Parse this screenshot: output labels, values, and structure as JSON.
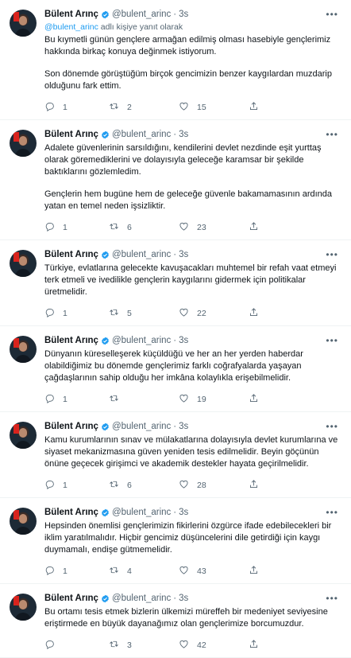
{
  "author": {
    "name": "Bülent Arınç",
    "handle": "@bulent_arinc",
    "time": "3s",
    "verified": true
  },
  "reply_prefix": "@bulent_arinc",
  "reply_suffix": "adlı kişiye yanıt olarak",
  "colors": {
    "accent": "#1d9bf0",
    "text": "#0f1419",
    "muted": "#536471"
  },
  "icons": {
    "reply": "reply-icon",
    "retweet": "retweet-icon",
    "like": "heart-icon",
    "share": "share-icon",
    "more": "more-icon"
  },
  "tweets": [
    {
      "paragraphs": [
        "Bu kıymetli günün gençlere armağan edilmiş olması hasebiyle gençlerimiz hakkında birkaç konuya değinmek istiyorum.",
        "Son dönemde görüştüğüm birçok gencimizin benzer kaygılardan muzdarip olduğunu fark ettim."
      ],
      "replies": "1",
      "retweets": "2",
      "likes": "15"
    },
    {
      "paragraphs": [
        "Adalete güvenlerinin sarsıldığını, kendilerini devlet nezdinde eşit yurttaş olarak göremediklerini ve dolayısıyla geleceğe karamsar bir şekilde baktıklarını gözlemledim.",
        "Gençlerin hem bugüne hem de geleceğe güvenle bakamamasının ardında yatan en temel neden işsizliktir."
      ],
      "replies": "1",
      "retweets": "6",
      "likes": "23"
    },
    {
      "paragraphs": [
        "Türkiye, evlatlarına gelecekte kavuşacakları muhtemel bir refah vaat etmeyi terk etmeli ve ivedilikle gençlerin kaygılarını gidermek için politikalar üretmelidir."
      ],
      "replies": "1",
      "retweets": "5",
      "likes": "22"
    },
    {
      "paragraphs": [
        "Dünyanın küreselleşerek küçüldüğü ve her an her yerden haberdar olabildiğimiz bu dönemde gençlerimiz farklı coğrafyalarda yaşayan çağdaşlarının sahip olduğu her imkâna kolaylıkla erişebilmelidir."
      ],
      "replies": "1",
      "retweets": "",
      "likes": "19"
    },
    {
      "paragraphs": [
        "Kamu kurumlarının sınav ve mülakatlarına dolayısıyla devlet kurumlarına ve siyaset mekanizmasına güven yeniden tesis edilmelidir. Beyin göçünün önüne geçecek girişimci ve akademik destekler hayata geçirilmelidir."
      ],
      "replies": "1",
      "retweets": "6",
      "likes": "28"
    },
    {
      "paragraphs": [
        "Hepsinden önemlisi gençlerimizin fikirlerini özgürce ifade edebilecekleri bir iklim yaratılmalıdır. Hiçbir gencimiz düşüncelerini dile getirdiği için kaygı duymamalı, endişe gütmemelidir."
      ],
      "replies": "1",
      "retweets": "4",
      "likes": "43"
    },
    {
      "paragraphs": [
        "Bu ortamı tesis etmek bizlerin ülkemizi müreffeh bir medeniyet seviyesine eriştirmede en büyük dayanağımız olan gençlerimize borcumuzdur."
      ],
      "replies": "",
      "retweets": "3",
      "likes": "42"
    }
  ]
}
